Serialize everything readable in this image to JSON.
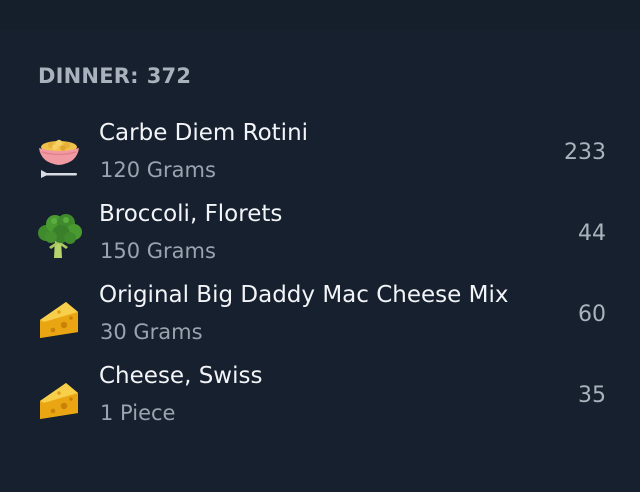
{
  "meal": {
    "title": "DINNER:",
    "calories": "372"
  },
  "items": [
    {
      "name": "Carbe Diem Rotini",
      "amount": "120 Grams",
      "calories": "233",
      "icon": "pasta-bowl-icon"
    },
    {
      "name": "Broccoli, Florets",
      "amount": "150 Grams",
      "calories": "44",
      "icon": "broccoli-icon"
    },
    {
      "name": "Original Big Daddy Mac Cheese Mix",
      "amount": "30 Grams",
      "calories": "60",
      "icon": "cheese-icon"
    },
    {
      "name": "Cheese, Swiss",
      "amount": "1 Piece",
      "calories": "35",
      "icon": "cheese-icon"
    }
  ],
  "colors": {
    "background": "#16202e",
    "header_text": "#a9b1bd",
    "primary_text": "#f2f4f7",
    "secondary_text": "#9aa3af"
  }
}
